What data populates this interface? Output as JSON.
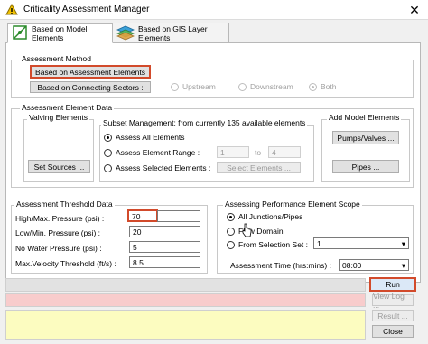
{
  "window": {
    "title": "Criticality Assessment Manager",
    "close_glyph": "✕"
  },
  "tabs": [
    {
      "label": "Based on Model Elements"
    },
    {
      "label": "Based on GIS Layer Elements"
    }
  ],
  "assessment_method": {
    "group_label": "Assessment Method",
    "btn_assessment_elements": "Based on Assessment Elements",
    "btn_connecting_sectors": "Based on Connecting Sectors :",
    "radio_upstream": "Upstream",
    "radio_downstream": "Downstream",
    "radio_both": "Both"
  },
  "element_data": {
    "group_label": "Assessment Element Data",
    "valving_label": "Valving Elements",
    "set_sources": "Set Sources ...",
    "subset_label": "Subset Management: from currently 135 available elements",
    "radio_all": "Assess All Elements",
    "radio_range": "Assess Element Range :",
    "radio_selected": "Assess Selected Elements :",
    "range_from": "1",
    "range_to_label": "to",
    "range_to": "4",
    "select_elements": "Select Elements ..."
  },
  "add_model": {
    "label": "Add Model Elements",
    "pumps_valves": "Pumps/Valves ...",
    "pipes": "Pipes ..."
  },
  "threshold": {
    "group_label": "Assessment Threshold Data",
    "rows": [
      {
        "label": "High/Max. Pressure (psi) :",
        "value": "70"
      },
      {
        "label": "Low/Min. Pressure (psi) :",
        "value": "20"
      },
      {
        "label": "No Water Pressure (psi) :",
        "value": "5"
      },
      {
        "label": "Max.Velocity Threshold (ft/s) :",
        "value": "8.5"
      }
    ]
  },
  "scope": {
    "group_label": "Assessing Performance Element Scope",
    "radio_all_junctions": "All Junctions/Pipes",
    "radio_flow_domain": "Flow Domain",
    "radio_selection_set": "From Selection Set :",
    "selection_set_value": "1",
    "time_label": "Assessment Time (hrs:mins) :",
    "time_value": "08:00"
  },
  "actions": {
    "run": "Run",
    "view_log": "View Log ...",
    "result": "Result ...",
    "close": "Close"
  },
  "colors": {
    "highlight": "#d24a2b",
    "status_pink": "#f8cccc",
    "status_yellow": "#fcfcc0"
  }
}
